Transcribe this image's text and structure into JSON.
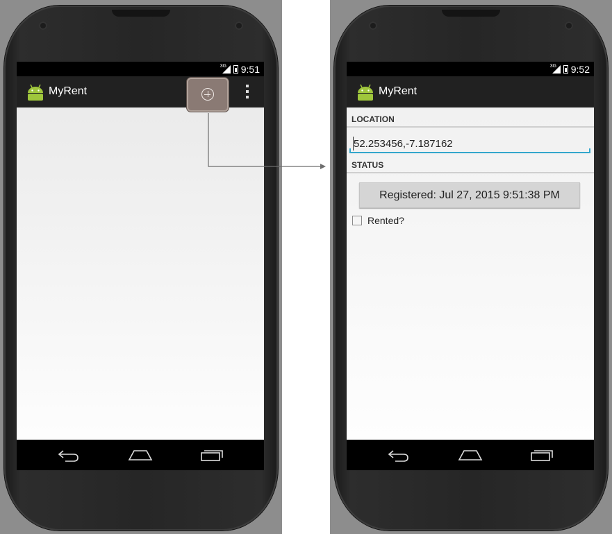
{
  "left_phone": {
    "status_bar": {
      "network": "3G",
      "time": "9:51"
    },
    "action_bar": {
      "title": "MyRent",
      "add_icon": "add-circle-icon",
      "overflow_icon": "overflow-menu-icon"
    },
    "nav_bar": {
      "icons": [
        "back-icon",
        "home-icon",
        "recent-apps-icon"
      ]
    }
  },
  "right_phone": {
    "status_bar": {
      "network": "3G",
      "time": "9:52"
    },
    "action_bar": {
      "title": "MyRent"
    },
    "location_header": "LOCATION",
    "location_value": "52.253456,-7.187162",
    "status_header": "STATUS",
    "date_button_label": "Registered: Jul 27, 2015 9:51:38 PM",
    "rented_label": "Rented?",
    "rented_checked": false,
    "nav_bar": {
      "icons": [
        "back-icon",
        "home-icon",
        "recent-apps-icon"
      ]
    }
  },
  "colors": {
    "action_bar": "#212121",
    "highlight": "#8a7a74",
    "input_underline": "#33a6cc",
    "android_green": "#9fc63c"
  }
}
